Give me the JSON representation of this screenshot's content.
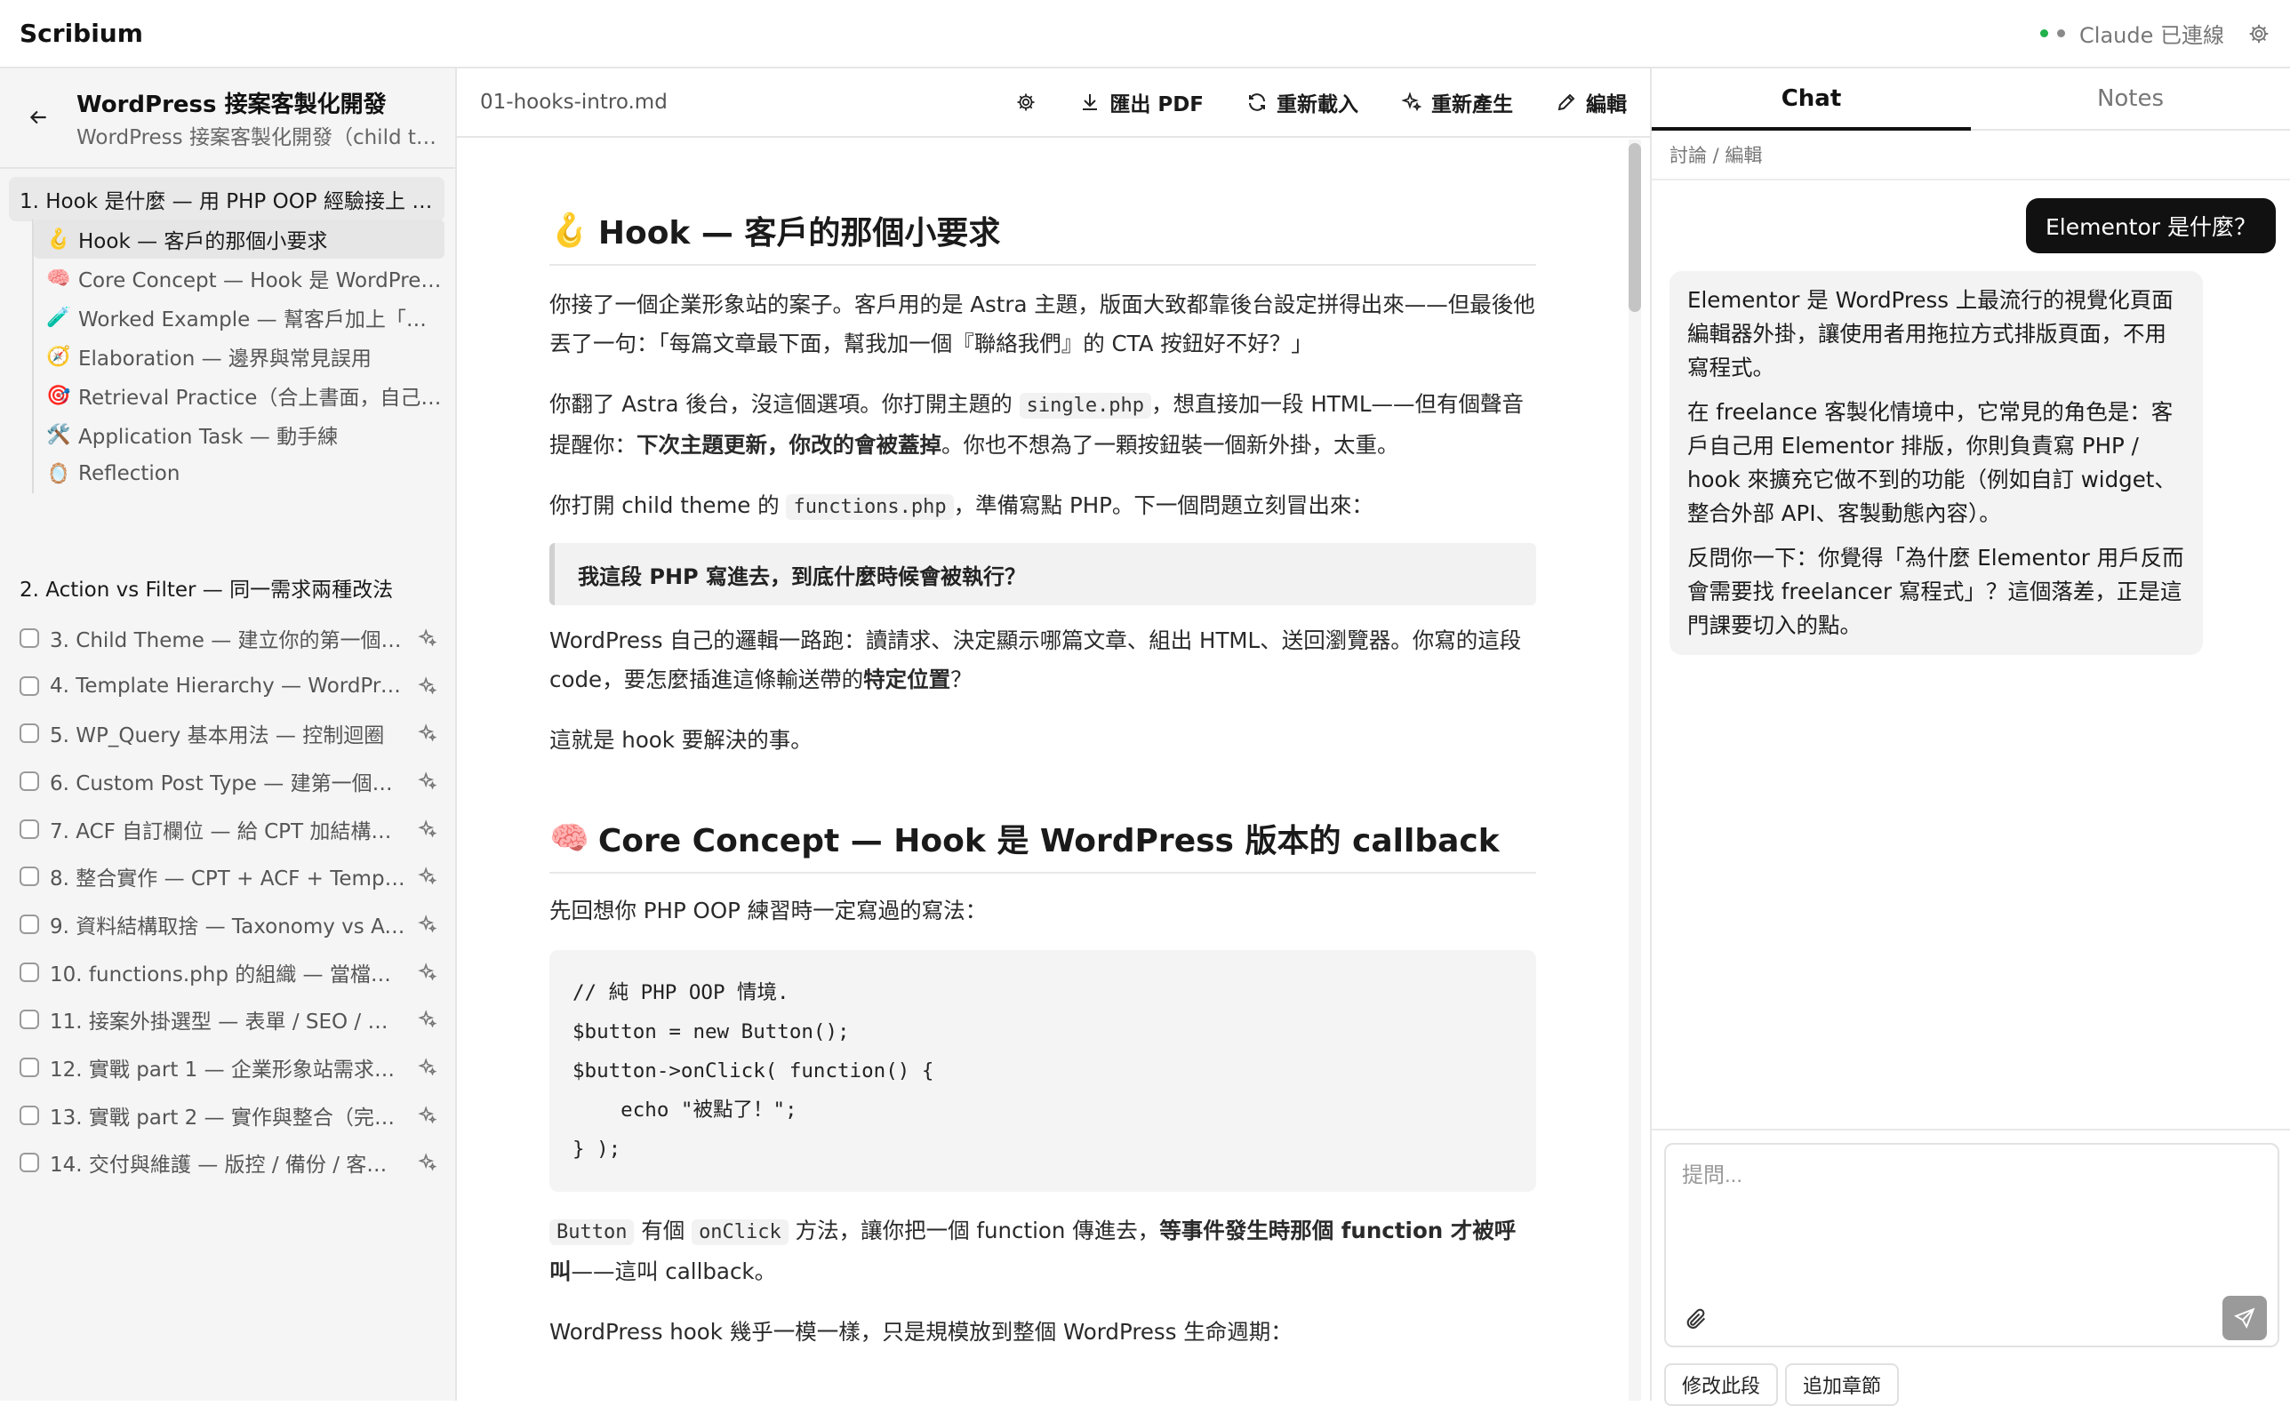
{
  "app": {
    "brand": "Scribium",
    "status_text": "Claude 已連線"
  },
  "course": {
    "title": "WordPress 接案客製化開發",
    "subtitle": "WordPress 接案客製化開發（child theme…"
  },
  "sidebar": {
    "active_chapter": "1. Hook 是什麼 — 用 PHP OOP 經驗接上 acti…",
    "sections": [
      {
        "emoji": "🪝",
        "label": "Hook — 客戶的那個小要求"
      },
      {
        "emoji": "🧠",
        "label": "Core Concept — Hook 是 WordPress …"
      },
      {
        "emoji": "🧪",
        "label": "Worked Example — 幫客戶加上「聯絡…"
      },
      {
        "emoji": "🧭",
        "label": "Elaboration — 邊界與常見誤用"
      },
      {
        "emoji": "🎯",
        "label": "Retrieval Practice（合上書面，自己回…"
      },
      {
        "emoji": "🛠️",
        "label": "Application Task — 動手練"
      },
      {
        "emoji": "🪞",
        "label": "Reflection"
      }
    ],
    "chapter2": "2. Action vs Filter — 同一需求兩種改法",
    "chapters": [
      "3. Child Theme — 建立你的第一個主題",
      "4. Template Hierarchy — WordPres…",
      "5. WP_Query 基本用法 — 控制迴圈",
      "6. Custom Post Type — 建第一個「…",
      "7. ACF 自訂欄位 — 給 CPT 加結構化…",
      "8. 整合實作 — CPT + ACF + Templat…",
      "9. 資料結構取捨 — Taxonomy vs AC…",
      "10. functions.php 的組織 — 當檔案…",
      "11. 接案外掛選型 — 表單 / SEO / 備份…",
      "12. 實戰 part 1 — 企業形象站需求分…",
      "13. 實戰 part 2 — 實作與整合（完整…",
      "14. 交付與維護 — 版控 / 備份 / 客戶…"
    ]
  },
  "toolbar": {
    "file": "01-hooks-intro.md",
    "export_pdf": "匯出 PDF",
    "reload": "重新載入",
    "regenerate": "重新產生",
    "edit": "編輯"
  },
  "article": {
    "h1_emoji": "🪝",
    "h1": "Hook — 客戶的那個小要求",
    "p1": "你接了一個企業形象站的案子。客戶用的是 Astra 主題，版面大致都靠後台設定拼得出來——但最後他丟了一句：「每篇文章最下面，幫我加一個『聯絡我們』的 CTA 按鈕好不好？」",
    "p2a": "你翻了 Astra 後台，沒這個選項。你打開主題的 ",
    "p2code": "single.php",
    "p2b": "，想直接加一段 HTML——但有個聲音提醒你：",
    "p2bold": "下次主題更新，你改的會被蓋掉",
    "p2c": "。你也不想為了一顆按鈕裝一個新外掛，太重。",
    "p3a": "你打開 child theme 的 ",
    "p3code": "functions.php",
    "p3b": "，準備寫點 PHP。下一個問題立刻冒出來：",
    "quote": "我這段 PHP 寫進去，到底什麼時候會被執行？",
    "p4a": "WordPress 自己的邏輯一路跑：讀請求、決定顯示哪篇文章、組出 HTML、送回瀏覽器。你寫的這段 code，要怎麼插進這條輸送帶的",
    "p4bold": "特定位置",
    "p4b": "？",
    "p5": "這就是 hook 要解決的事。",
    "h2_emoji": "🧠",
    "h2": "Core Concept — Hook 是 WordPress 版本的 callback",
    "p6": "先回想你 PHP OOP 練習時一定寫過的寫法：",
    "code": "// 純 PHP OOP 情境.\n$button = new Button();\n$button->onClick( function() {\n    echo \"被點了！\";\n} );",
    "p7code1": "Button",
    "p7a": " 有個 ",
    "p7code2": "onClick",
    "p7b": " 方法，讓你把一個 function 傳進去，",
    "p7bold": "等事件發生時那個 function 才被呼叫",
    "p7c": "——這叫 callback。",
    "p8": "WordPress hook 幾乎一模一樣，只是規模放到整個 WordPress 生命週期："
  },
  "right": {
    "tab_chat": "Chat",
    "tab_notes": "Notes",
    "crumb": "討論 / 編輯",
    "user_msg": "Elementor 是什麼？",
    "ai_p1": "Elementor 是 WordPress 上最流行的視覺化頁面編輯器外掛，讓使用者用拖拉方式排版頁面，不用寫程式。",
    "ai_p2": "在 freelance 客製化情境中，它常見的角色是：客戶自己用 Elementor 排版，你則負責寫 PHP / hook 來擴充它做不到的功能（例如自訂 widget、整合外部 API、客製動態內容）。",
    "ai_p3": "反問你一下：你覺得「為什麼 Elementor 用戶反而會需要找 freelancer 寫程式」？這個落差，正是這門課要切入的點。",
    "placeholder": "提問...",
    "btn_modify": "修改此段",
    "btn_add": "追加章節"
  }
}
